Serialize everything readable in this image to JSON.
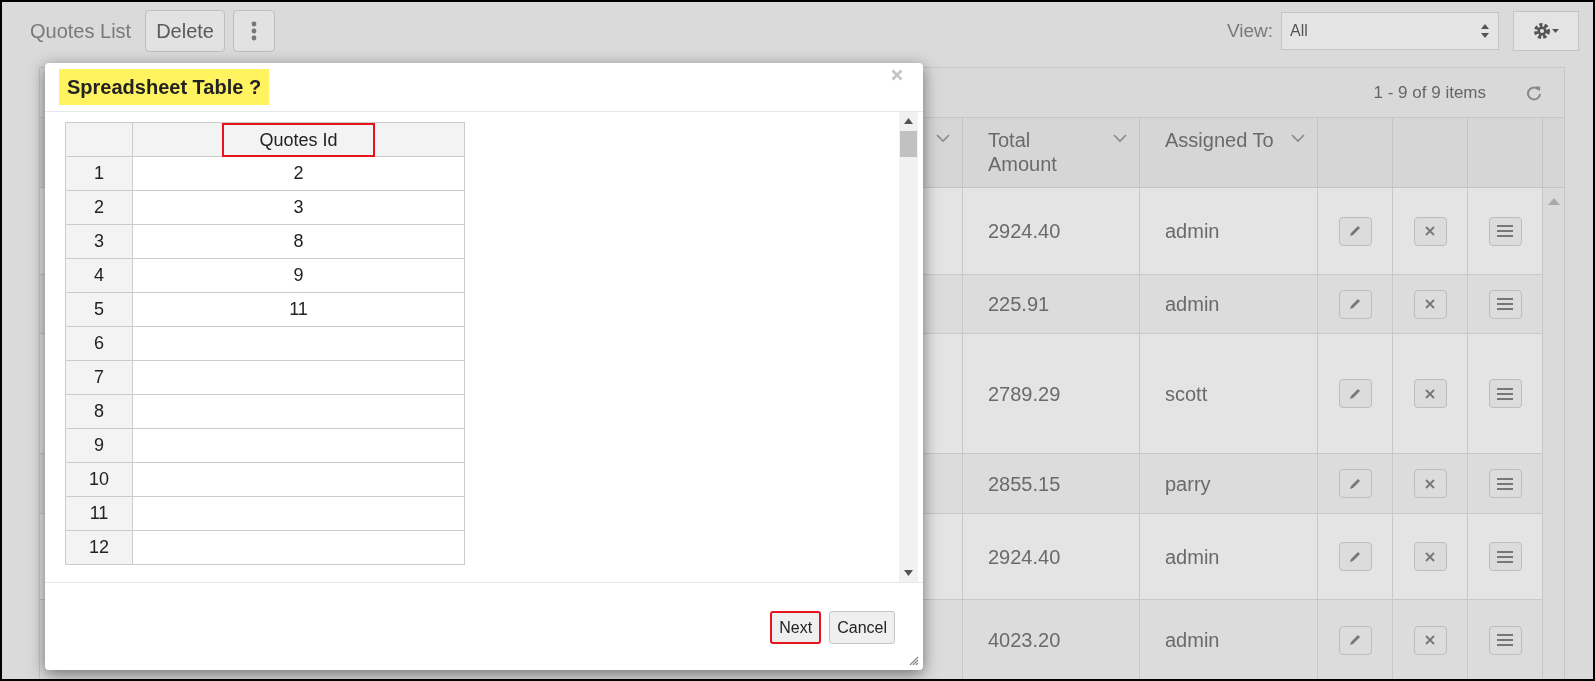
{
  "page": {
    "title": "Quotes List",
    "delete_button": "Delete",
    "view_label": "View:",
    "view_value": "All"
  },
  "grid": {
    "pager": "1 - 9 of 9 items",
    "columns": [
      "Total Amount",
      "Assigned To"
    ],
    "rows": [
      {
        "total_amount": "2924.40",
        "assigned_to": "admin"
      },
      {
        "total_amount": "225.91",
        "assigned_to": "admin"
      },
      {
        "total_amount": "2789.29",
        "assigned_to": "scott"
      },
      {
        "total_amount": "2855.15",
        "assigned_to": "parry"
      },
      {
        "total_amount": "2924.40",
        "assigned_to": "admin"
      },
      {
        "total_amount": "4023.20",
        "assigned_to": "admin"
      }
    ]
  },
  "dialog": {
    "title": "Spreadsheet Table ?",
    "sheet": {
      "column": "Quotes Id",
      "column_highlighted": true,
      "row_numbers": [
        "1",
        "2",
        "3",
        "4",
        "5",
        "6",
        "7",
        "8",
        "9",
        "10",
        "11",
        "12"
      ],
      "values": [
        "2",
        "3",
        "8",
        "9",
        "11"
      ]
    },
    "buttons": [
      {
        "label": "Next",
        "highlighted": true
      },
      {
        "label": "Cancel",
        "highlighted": false
      }
    ]
  }
}
